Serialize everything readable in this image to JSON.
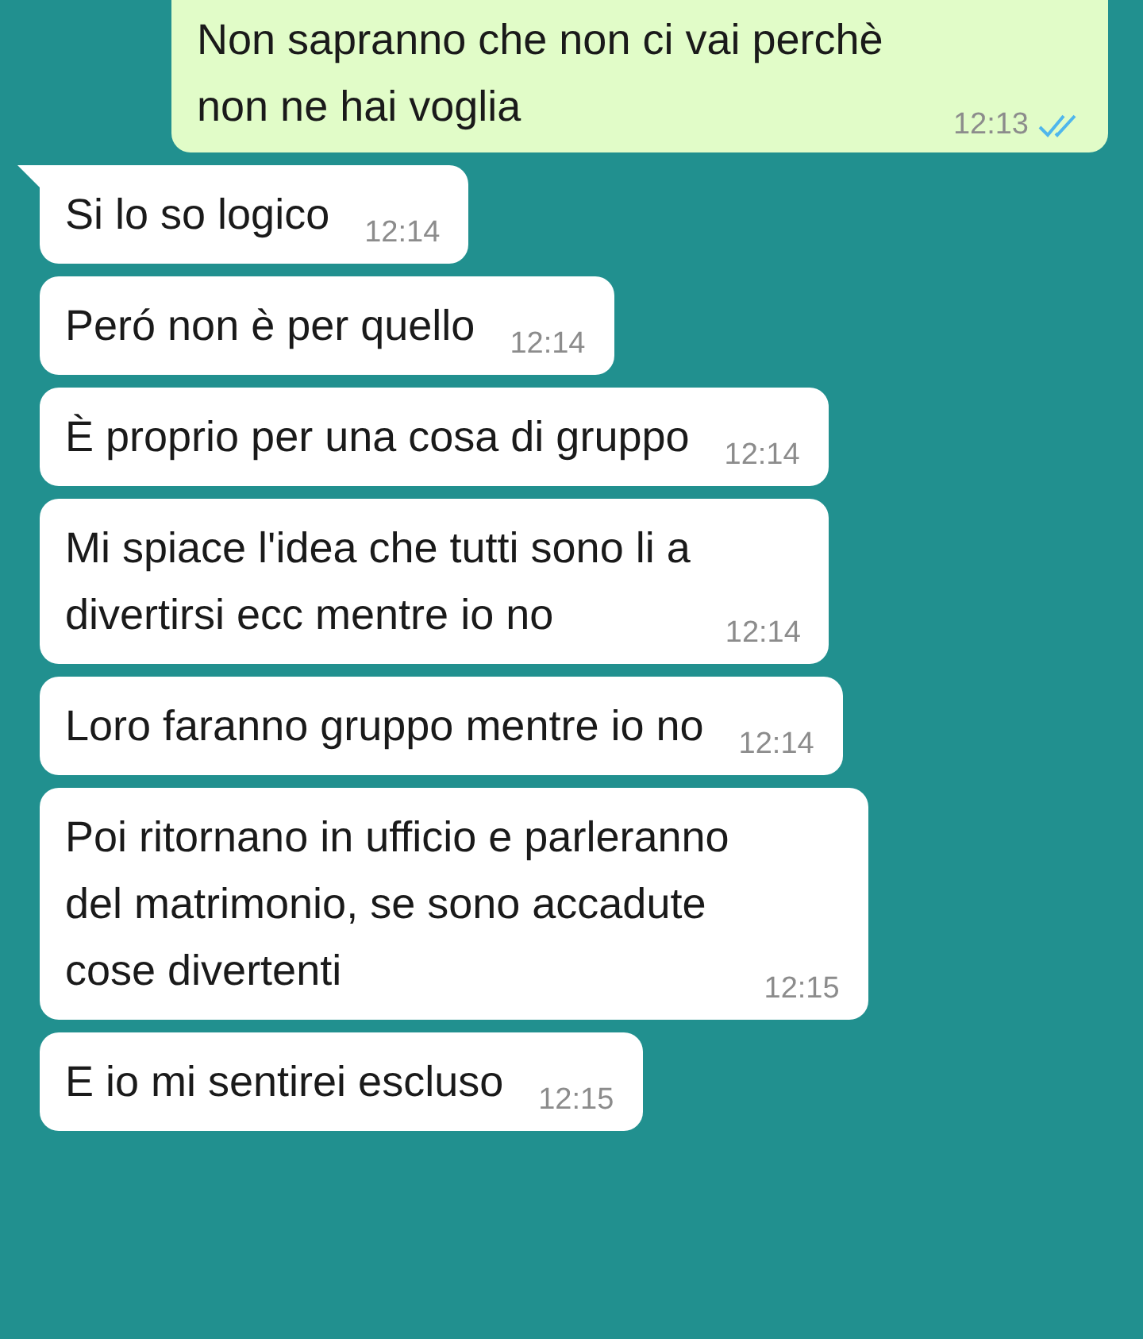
{
  "messages": [
    {
      "kind": "sent",
      "text": "Non sapranno che non ci vai perchè\nnon ne hai voglia",
      "time": "12:13",
      "read": true,
      "tail": false
    },
    {
      "kind": "received",
      "text": "Si lo so logico",
      "time": "12:14",
      "tail": true
    },
    {
      "kind": "received",
      "text": "Peró non è per quello",
      "time": "12:14",
      "tail": false
    },
    {
      "kind": "received",
      "text": "È proprio per una cosa di gruppo",
      "time": "12:14",
      "tail": false
    },
    {
      "kind": "received",
      "text": "Mi spiace l'idea che tutti sono li a\ndivertirsi ecc mentre io no",
      "time": "12:14",
      "tail": false
    },
    {
      "kind": "received",
      "text": "Loro faranno gruppo mentre io no",
      "time": "12:14",
      "tail": false
    },
    {
      "kind": "received",
      "text": "Poi ritornano in ufficio e parleranno\ndel matrimonio, se sono accadute\ncose divertenti",
      "time": "12:15",
      "tail": false
    },
    {
      "kind": "received",
      "text": "E io mi sentirei escluso",
      "time": "12:15",
      "tail": false
    }
  ]
}
